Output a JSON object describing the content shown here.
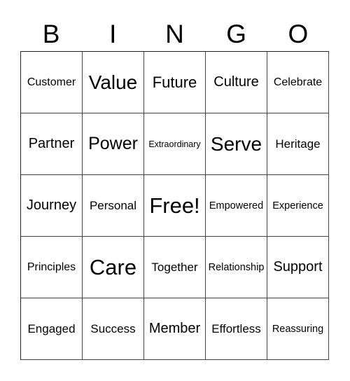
{
  "header": {
    "letters": [
      "B",
      "I",
      "N",
      "G",
      "O"
    ]
  },
  "rows": [
    [
      "Customer",
      "Value",
      "Future",
      "Culture",
      "Celebrate"
    ],
    [
      "Partner",
      "Power",
      "Extraordinary",
      "Serve",
      "Heritage"
    ],
    [
      "Journey",
      "Personal",
      "Free!",
      "Empowered",
      "Experience"
    ],
    [
      "Principles",
      "Care",
      "Together",
      "Relationship",
      "Support"
    ],
    [
      "Engaged",
      "Success",
      "Member",
      "Effortless",
      "Reassuring"
    ]
  ]
}
